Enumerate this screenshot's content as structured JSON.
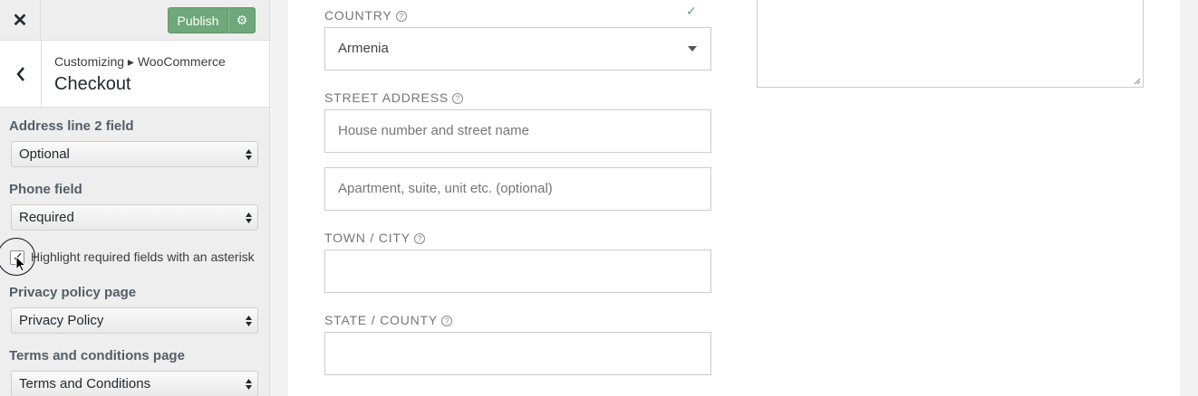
{
  "header": {
    "close_icon": "close-icon",
    "publish_label": "Publish",
    "settings_icon": "gear-icon"
  },
  "section": {
    "back_icon": "chevron-left-icon",
    "breadcrumb": "Customizing ▸ WooCommerce",
    "title": "Checkout"
  },
  "controls": {
    "address2": {
      "label": "Address line 2 field",
      "value": "Optional"
    },
    "phone": {
      "label": "Phone field",
      "value": "Required"
    },
    "asterisk": {
      "label": "Highlight required fields with an asterisk",
      "checked": true
    },
    "privacy": {
      "label": "Privacy policy page",
      "value": "Privacy Policy"
    },
    "terms": {
      "label": "Terms and conditions page",
      "value": "Terms and Conditions"
    }
  },
  "preview": {
    "country": {
      "label": "COUNTRY",
      "value": "Armenia"
    },
    "street": {
      "label": "STREET ADDRESS",
      "placeholder1": "House number and street name",
      "placeholder2": "Apartment, suite, unit etc. (optional)"
    },
    "town": {
      "label": "TOWN / CITY"
    },
    "state": {
      "label": "STATE / COUNTY"
    },
    "help_icon": "question-circle-icon",
    "valid_icon": "checkmark-icon"
  },
  "colors": {
    "publish": "#6fa87a",
    "valid": "#4caf75"
  }
}
